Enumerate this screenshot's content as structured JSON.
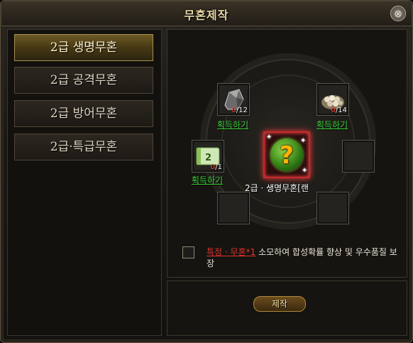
{
  "window": {
    "title": "무혼제작",
    "close_label": "⊗"
  },
  "tabs": [
    {
      "label": "2급 생명무혼",
      "active": true
    },
    {
      "label": "2급 공격무혼",
      "active": false
    },
    {
      "label": "2급 방어무혼",
      "active": false
    },
    {
      "label": "2급·특급무혼",
      "active": false
    }
  ],
  "materials": [
    {
      "icon": "ore-icon",
      "have": "0",
      "need": "/12",
      "link": "획득하기"
    },
    {
      "icon": "pearls-icon",
      "have": "0",
      "need": "/14",
      "link": "획득하기"
    },
    {
      "icon": "scroll-icon",
      "have": "0",
      "need": "/1",
      "link": "획득하기"
    }
  ],
  "result": {
    "label": "2급 · 생명무혼[랜"
  },
  "option": {
    "link": "특정 · 무혼*1",
    "text": " 소모하여 합성확률 향상 및 우수품질 보장"
  },
  "make_button": "제작"
}
